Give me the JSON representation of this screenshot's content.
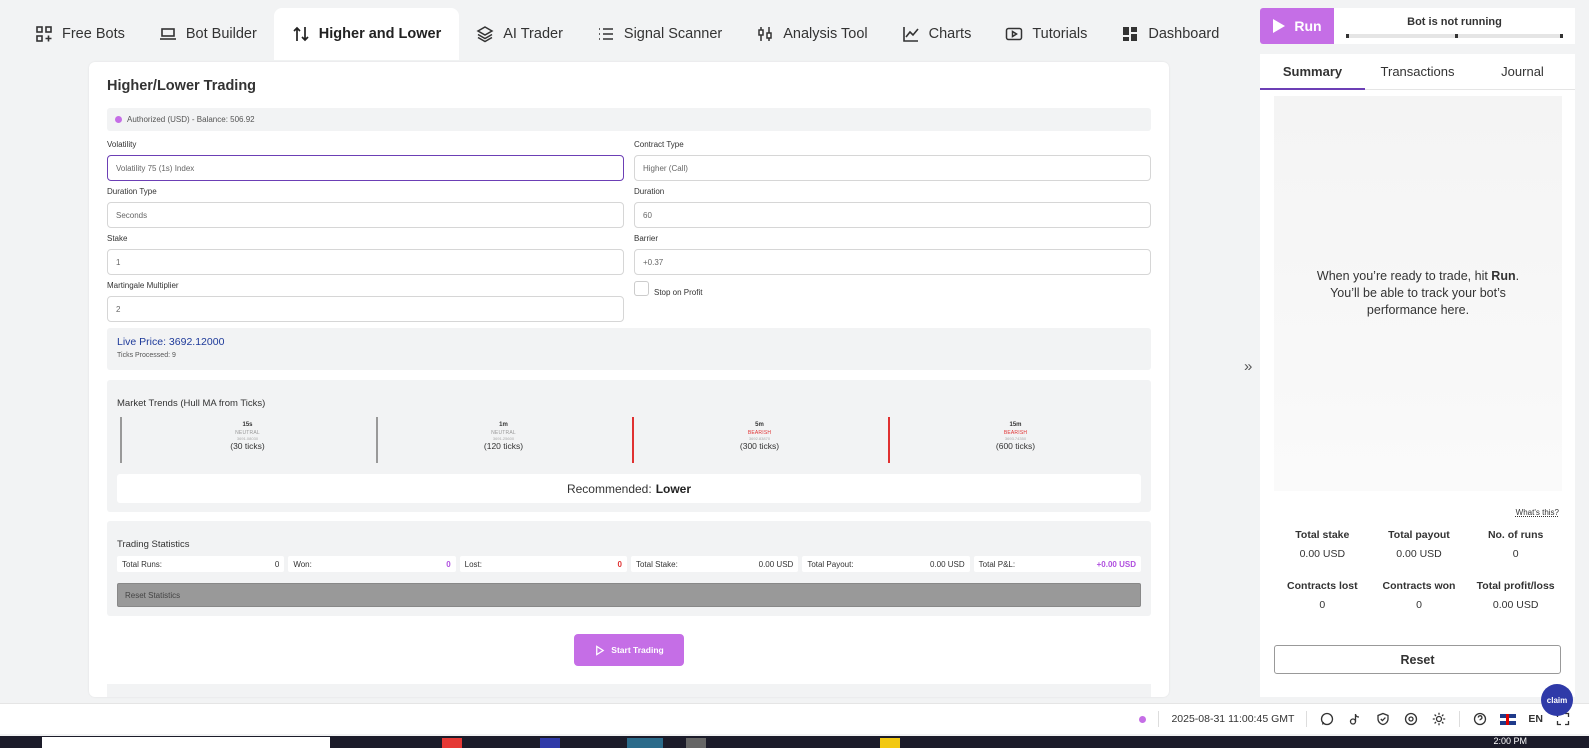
{
  "nav": {
    "tabs": [
      {
        "label": "Free Bots",
        "icon": "grid-plus-icon"
      },
      {
        "label": "Bot Builder",
        "icon": "builder-icon"
      },
      {
        "label": "Higher and Lower",
        "icon": "up-down-arrows-icon",
        "active": true
      },
      {
        "label": "AI Trader",
        "icon": "layers-icon"
      },
      {
        "label": "Signal Scanner",
        "icon": "list-icon"
      },
      {
        "label": "Analysis Tool",
        "icon": "sliders-icon"
      },
      {
        "label": "Charts",
        "icon": "line-chart-icon"
      },
      {
        "label": "Tutorials",
        "icon": "play-icon"
      },
      {
        "label": "Dashboard",
        "icon": "dashboard-icon"
      }
    ]
  },
  "main": {
    "title": "Higher/Lower Trading",
    "auth": "Authorized (USD) - Balance: 506.92",
    "fields": {
      "volatility": {
        "label": "Volatility",
        "value": "Volatility 75 (1s) Index"
      },
      "contract_type": {
        "label": "Contract Type",
        "value": "Higher (Call)"
      },
      "duration_type": {
        "label": "Duration Type",
        "value": "Seconds"
      },
      "duration": {
        "label": "Duration",
        "value": "60"
      },
      "stake": {
        "label": "Stake",
        "value": "1"
      },
      "barrier": {
        "label": "Barrier",
        "value": "+0.37"
      },
      "martingale": {
        "label": "Martingale Multiplier",
        "value": "2"
      }
    },
    "stop_on_profit": "Stop on Profit",
    "live_price": "Live Price: 3692.12000",
    "ticks_processed": "Ticks Processed: 9",
    "trends": {
      "title": "Market Trends (Hull MA from Ticks)",
      "items": [
        {
          "tf": "15s",
          "state": "NEUTRAL",
          "sub": "3691.08030",
          "ticks": "(30 ticks)"
        },
        {
          "tf": "1m",
          "state": "NEUTRAL",
          "sub": "3691.25600",
          "ticks": "(120 ticks)"
        },
        {
          "tf": "5m",
          "state": "BEARISH",
          "sub": "3692.83870",
          "ticks": "(300 ticks)"
        },
        {
          "tf": "15m",
          "state": "BEARISH",
          "sub": "3693.74350",
          "ticks": "(600 ticks)"
        }
      ],
      "recommended_label": "Recommended:",
      "recommended_value": "Lower"
    },
    "stats": {
      "title": "Trading Statistics",
      "items": [
        {
          "label": "Total Runs:",
          "value": "0"
        },
        {
          "label": "Won:",
          "value": "0"
        },
        {
          "label": "Lost:",
          "value": "0"
        },
        {
          "label": "Total Stake:",
          "value": "0.00 USD"
        },
        {
          "label": "Total Payout:",
          "value": "0.00 USD"
        },
        {
          "label": "Total P&L:",
          "value": "+0.00 USD"
        }
      ],
      "reset": "Reset Statistics"
    },
    "start": "Start Trading"
  },
  "run": {
    "button": "Run",
    "status": "Bot is not running"
  },
  "side": {
    "tabs": [
      "Summary",
      "Transactions",
      "Journal"
    ],
    "empty_1": "When you’re ready to trade, hit ",
    "empty_bold": "Run",
    "empty_2": ". You’ll be able to track your bot’s performance here.",
    "whats_this": "What's this?",
    "summary": [
      {
        "label": "Total stake",
        "value": "0.00 USD"
      },
      {
        "label": "Total payout",
        "value": "0.00 USD"
      },
      {
        "label": "No. of runs",
        "value": "0"
      },
      {
        "label": "Contracts lost",
        "value": "0"
      },
      {
        "label": "Contracts won",
        "value": "0"
      },
      {
        "label": "Total profit/loss",
        "value": "0.00 USD"
      }
    ],
    "reset": "Reset"
  },
  "footer": {
    "timestamp": "2025-08-31 11:00:45 GMT",
    "language": "EN",
    "chat_label": "claim"
  },
  "taskbar": {
    "time": "2:00 PM"
  },
  "colors": {
    "accent": "#c56ee6",
    "focus": "#6c3fb5",
    "price": "#1e3a9a",
    "bearish": "#e03131"
  }
}
